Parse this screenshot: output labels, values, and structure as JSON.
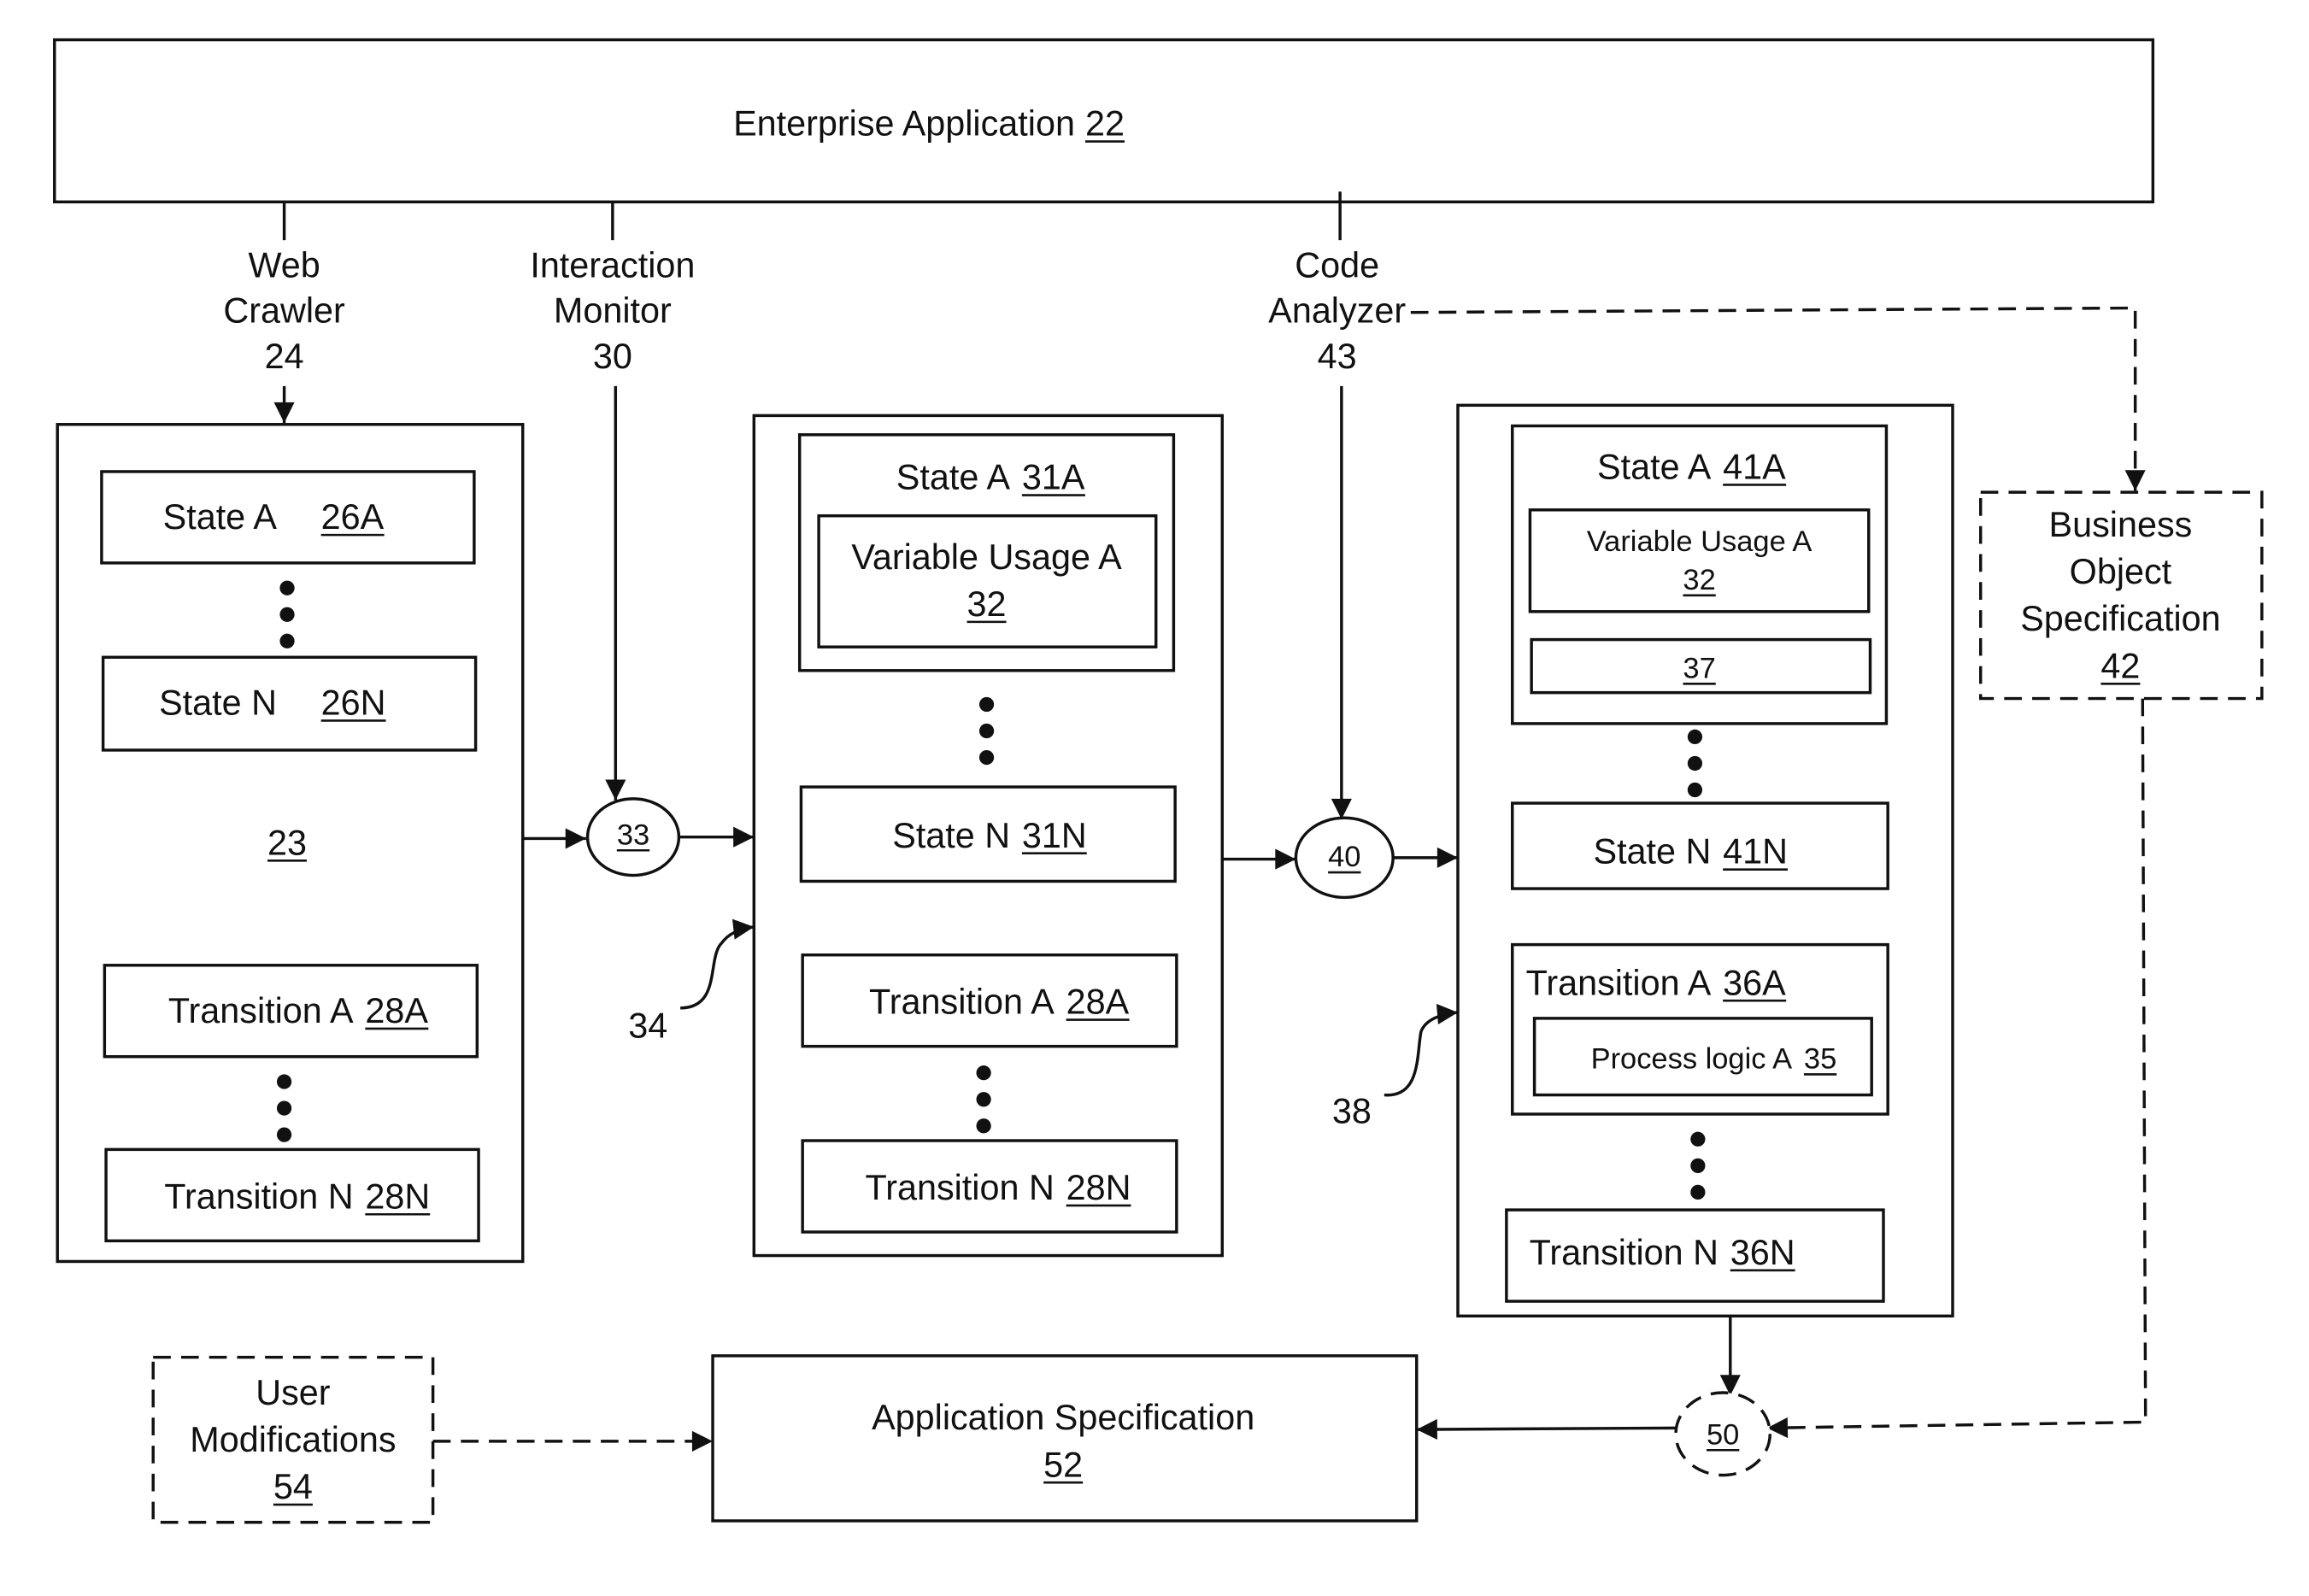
{
  "enterprise_app": {
    "label": "Enterprise Application",
    "ref": "22"
  },
  "sources": {
    "web_crawler": {
      "line1": "Web",
      "line2": "Crawler",
      "ref": "24"
    },
    "interaction_monitor": {
      "line1": "Interaction",
      "line2": "Monitor",
      "ref": "30"
    },
    "code_analyzer": {
      "line1": "Code",
      "line2": "Analyzer",
      "ref": "43"
    }
  },
  "model_23": {
    "ref": "23",
    "state_a": {
      "label": "State A",
      "ref": "26A"
    },
    "state_n": {
      "label": "State N",
      "ref": "26N"
    },
    "transition_a": {
      "label": "Transition A",
      "ref": "28A"
    },
    "transition_n": {
      "label": "Transition N",
      "ref": "28N"
    }
  },
  "merge_33": {
    "ref": "33"
  },
  "model_34": {
    "ref": "34",
    "state_a": {
      "label": "State A",
      "ref": "31A",
      "variable_usage": {
        "label": "Variable Usage A",
        "ref": "32"
      }
    },
    "state_n": {
      "label": "State N",
      "ref": "31N"
    },
    "transition_a": {
      "label": "Transition A",
      "ref": "28A"
    },
    "transition_n": {
      "label": "Transition N",
      "ref": "28N"
    }
  },
  "merge_40": {
    "ref": "40"
  },
  "model_38": {
    "ref": "38",
    "state_a": {
      "label": "State A",
      "ref": "41A",
      "variable_usage": {
        "label": "Variable Usage A",
        "ref": "32"
      },
      "sub_ref": "37"
    },
    "state_n": {
      "label": "State N",
      "ref": "41N"
    },
    "transition_a": {
      "label": "Transition A",
      "ref": "36A",
      "process_logic": {
        "label": "Process logic A",
        "ref": "35"
      }
    },
    "transition_n": {
      "label": "Transition N",
      "ref": "36N"
    }
  },
  "business_object_spec": {
    "line1": "Business",
    "line2": "Object",
    "line3": "Specification",
    "ref": "42"
  },
  "merge_50": {
    "ref": "50"
  },
  "application_spec": {
    "label": "Application Specification",
    "ref": "52"
  },
  "user_modifications": {
    "line1": "User",
    "line2": "Modifications",
    "ref": "54"
  }
}
